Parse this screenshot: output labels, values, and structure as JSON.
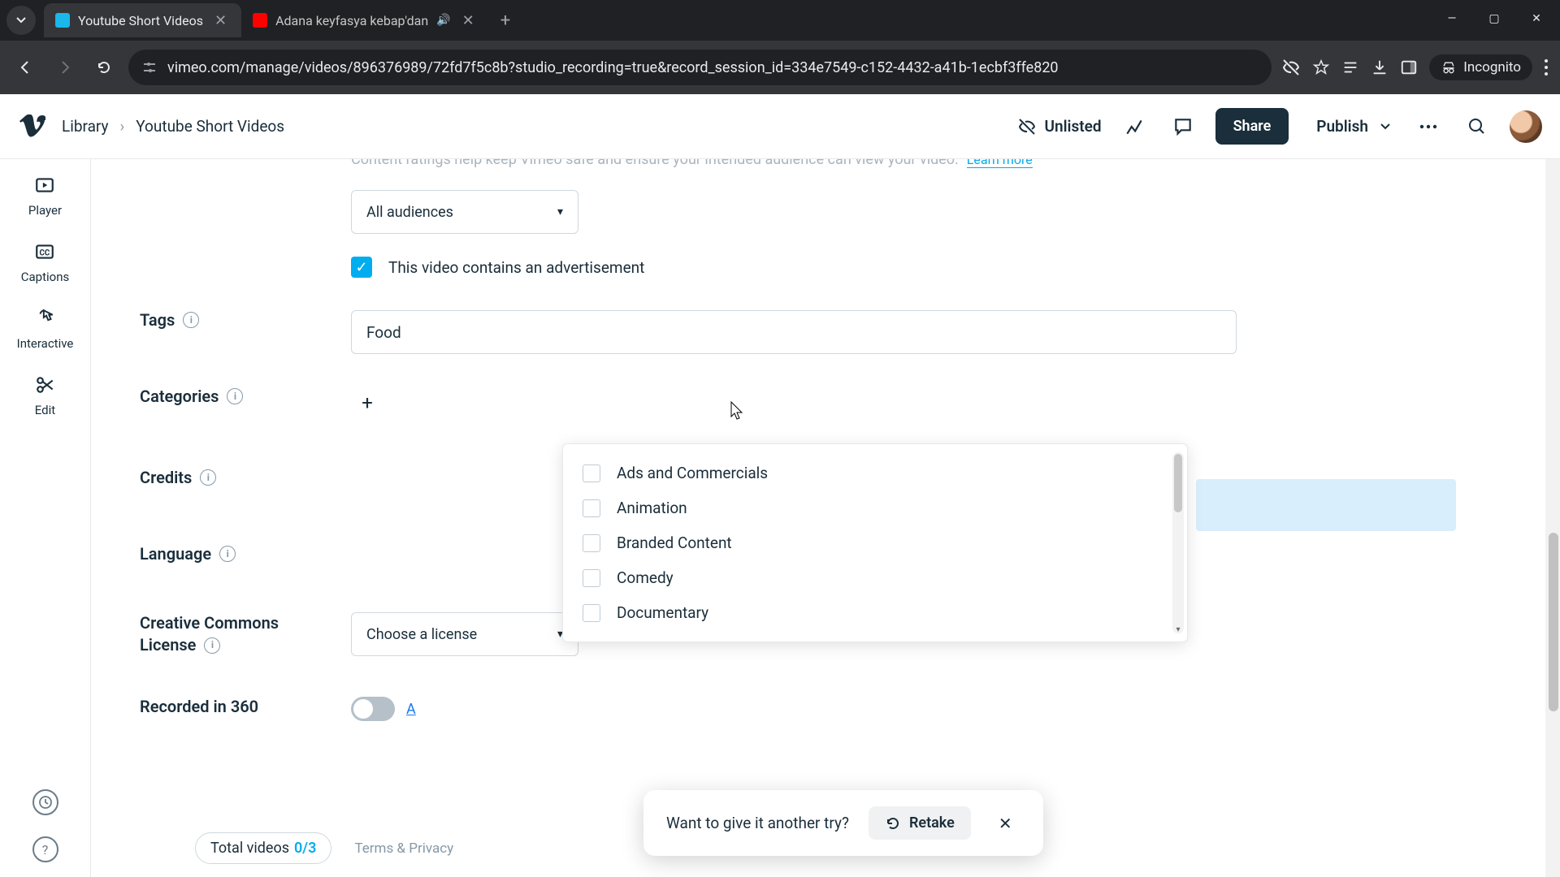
{
  "browser": {
    "tabs": [
      {
        "title": "Youtube Short Videos",
        "favicon": "vimeo",
        "active": true
      },
      {
        "title": "Adana keyfasya kebap'dan",
        "favicon": "yt",
        "audio": true,
        "active": false
      }
    ],
    "url": "vimeo.com/manage/videos/896376989/72fd7f5c8b?studio_recording=true&record_session_id=334e7549-c152-4432-a41b-1ecbf3ffe820",
    "incognito_label": "Incognito"
  },
  "header": {
    "breadcrumb_library": "Library",
    "breadcrumb_current": "Youtube Short Videos",
    "unlisted": "Unlisted",
    "share": "Share",
    "publish": "Publish"
  },
  "rail": {
    "player": "Player",
    "captions": "Captions",
    "interactive": "Interactive",
    "edit": "Edit"
  },
  "form": {
    "cut_text": "Content ratings help keep Vimeo safe and ensure your intended audience can view your video.",
    "learn_more": "Learn more",
    "audience_select": "All audiences",
    "ad_checkbox_label": "This video contains an advertisement",
    "tags_label": "Tags",
    "tags_value": "Food",
    "categories_label": "Categories",
    "credits_label": "Credits",
    "language_label": "Language",
    "cc_label_line1": "Creative Commons",
    "cc_label_line2": "License",
    "cc_select": "Choose a license",
    "recorded360_label": "Recorded in 360",
    "toggle_a": "A"
  },
  "categories": [
    "Ads and Commercials",
    "Animation",
    "Branded Content",
    "Comedy",
    "Documentary"
  ],
  "footer": {
    "total_label": "Total videos",
    "total_count": "0/3",
    "terms": "Terms & Privacy"
  },
  "toast": {
    "text": "Want to give it another try?",
    "retake": "Retake"
  }
}
